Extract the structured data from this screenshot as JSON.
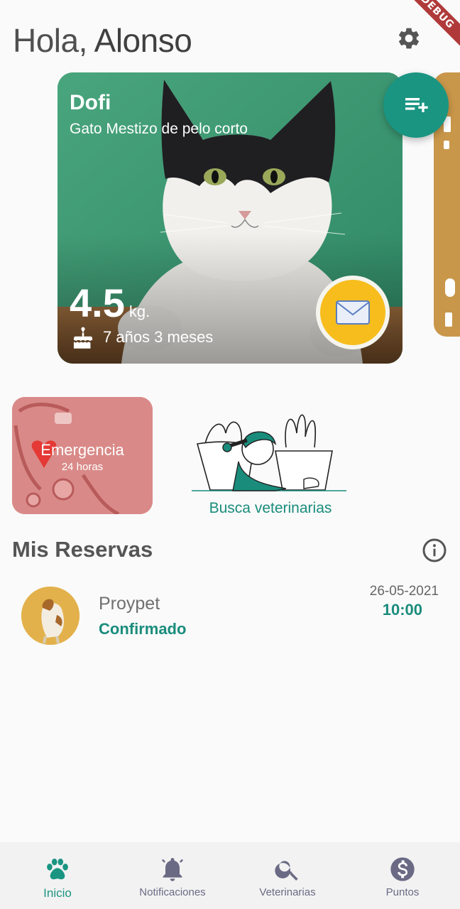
{
  "debug_banner": "DEBUG",
  "header": {
    "greeting_prefix": "Hola,",
    "user_name": "Alonso"
  },
  "pet": {
    "name": "Dofi",
    "breed": "Gato Mestizo de pelo corto",
    "weight_value": "4.5",
    "weight_unit": "kg.",
    "age": "7 años 3 meses"
  },
  "quick_actions": {
    "emergency_title": "Emergencia",
    "emergency_subtitle": "24 horas",
    "vets_label": "Busca veterinarias"
  },
  "reservations": {
    "title": "Mis Reservas",
    "items": [
      {
        "clinic": "Proypet",
        "status": "Confirmado",
        "date": "26-05-2021",
        "time": "10:00"
      }
    ]
  },
  "bottom_nav": [
    {
      "label": "Inicio",
      "icon": "paw-icon",
      "active": true
    },
    {
      "label": "Notificaciones",
      "icon": "bell-icon",
      "active": false
    },
    {
      "label": "Veterinarias",
      "icon": "search-icon",
      "active": false
    },
    {
      "label": "Puntos",
      "icon": "dollar-icon",
      "active": false
    }
  ],
  "colors": {
    "accent": "#1a9582",
    "mail_button": "#f6bd1d",
    "emergency_card": "#d98a88",
    "nav_inactive": "#6a6a85"
  }
}
